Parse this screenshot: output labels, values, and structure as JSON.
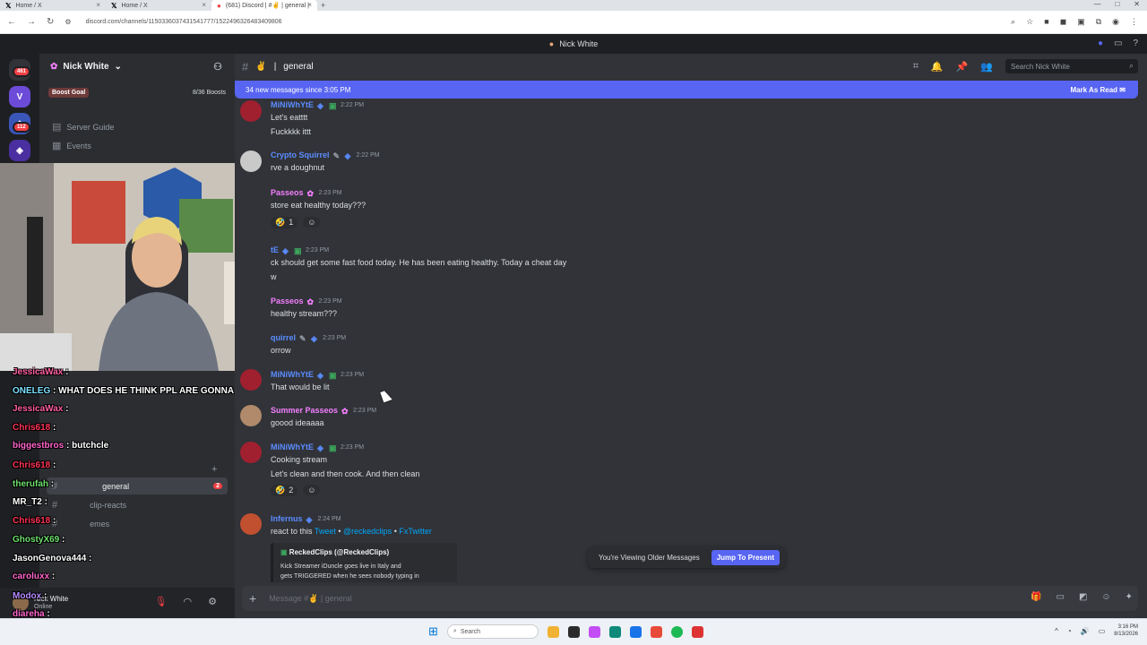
{
  "browser": {
    "tabs": [
      {
        "label": "Home / X",
        "icon": "x-logo-icon"
      },
      {
        "label": "Home / X",
        "icon": "x-logo-icon"
      },
      {
        "label": "(681) Discord | #✌ | general |",
        "icon": "discord-icon"
      }
    ],
    "url": "discord.com/channels/1150336037431541777/1522496326483409806"
  },
  "window_title": "Nick White",
  "server_rail": {
    "badges": [
      "461",
      "112"
    ]
  },
  "sidebar": {
    "server_name": "Nick White",
    "boost_label": "Boost Goal",
    "boost_progress": "8/36 Boosts",
    "nav": [
      {
        "label": "Server Guide",
        "icon": "server-guide-icon"
      },
      {
        "label": "Events",
        "icon": "calendar-icon"
      }
    ],
    "channels": [
      {
        "label": "general",
        "active": true,
        "mentions": "2"
      },
      {
        "label": "clip-reacts",
        "active": false
      },
      {
        "label": "emes",
        "active": false
      }
    ]
  },
  "stream_chat": [
    {
      "user": "JessicaWax",
      "color": "#ff5fa2",
      "msg": ""
    },
    {
      "user": "ONELEG",
      "color": "#7be0ff",
      "msg": "WHAT DOES HE THINK PPL ARE GONNA CLP"
    },
    {
      "user": "JessicaWax",
      "color": "#ff5fa2",
      "msg": ""
    },
    {
      "user": "Chris618",
      "color": "#ff3355",
      "msg": ""
    },
    {
      "user": "biggestbros",
      "color": "#ff66cc",
      "msg": "butchcle"
    },
    {
      "user": "Chris618",
      "color": "#ff3355",
      "msg": ""
    },
    {
      "user": "therufah",
      "color": "#6fe06f",
      "msg": ""
    },
    {
      "user": "MR_T2",
      "color": "#ffffff",
      "msg": ""
    },
    {
      "user": "Chris618",
      "color": "#ff3355",
      "msg": ""
    },
    {
      "user": "GhostyX69",
      "color": "#6fe06f",
      "msg": ""
    },
    {
      "user": "JasonGenova444",
      "color": "#ffffff",
      "msg": ""
    },
    {
      "user": "caroluxx",
      "color": "#ff66cc",
      "msg": ""
    },
    {
      "user": "Modox",
      "color": "#b58cff",
      "msg": ""
    },
    {
      "user": "diareha",
      "color": "#ff66cc",
      "msg": ""
    }
  ],
  "user_panel": {
    "name": "Nick White",
    "status": "Online"
  },
  "channel": {
    "name": "general",
    "search_placeholder": "Search Nick White",
    "new_messages": "34 new messages since 3:05 PM",
    "mark_read": "Mark As Read"
  },
  "messages": [
    {
      "user": "MiNiWhYtE",
      "color": "#5865f2",
      "time": "2:22 PM",
      "lines": [
        "Let's eatttt",
        "Fuckkkk ittt"
      ]
    },
    {
      "user": "Crypto Squirrel",
      "color": "#5865f2",
      "time": "2:22 PM",
      "lines": [
        "rve a doughnut"
      ]
    },
    {
      "user": "Passeos",
      "color": "#f47fff",
      "time": "2:23 PM",
      "lines": [
        "store eat healthy today???"
      ],
      "reaction": "1"
    },
    {
      "user": "tE",
      "color": "#5865f2",
      "time": "2:23 PM",
      "lines": [
        "ck should get some fast food today. He has been eating healthy. Today a cheat day",
        "w"
      ]
    },
    {
      "user": "Passeos",
      "color": "#f47fff",
      "time": "2:23 PM",
      "lines": [
        "healthy stream???"
      ]
    },
    {
      "user": "quirrel",
      "color": "#5865f2",
      "time": "2:23 PM",
      "lines": [
        "orrow"
      ]
    },
    {
      "user": "MiNiWhYtE",
      "color": "#5865f2",
      "time": "2:23 PM",
      "lines": [
        "That would be lit"
      ]
    },
    {
      "user": "Summer Passeos",
      "color": "#f47fff",
      "time": "2:23 PM",
      "lines": [
        "goood ideaaaa"
      ]
    },
    {
      "user": "MiNiWhYtE",
      "color": "#5865f2",
      "time": "2:23 PM",
      "lines": [
        "Cooking stream",
        "Let's clean and then cook. And then clean"
      ],
      "reaction": "2"
    },
    {
      "user": "Infernus",
      "color": "#5865f2",
      "time": "2:24 PM",
      "lines": [
        "react to this"
      ]
    }
  ],
  "tweet_line": {
    "prefix": "react to this ",
    "tweet": "Tweet",
    "handle": "@reckedclips",
    "fx": "FxTwitter",
    "dot": " • "
  },
  "embed": {
    "author": "ReckedClips (@ReckedClips)",
    "body_1": "Kick Streamer iDuncle goes live in Italy and",
    "body_2": "gets TRIGGERED when he sees nobody typing in"
  },
  "older_banner": {
    "text": "You're Viewing Older Messages",
    "jump": "Jump To Present"
  },
  "composer": {
    "placeholder": "Message #✌ | general"
  },
  "taskbar": {
    "search": "Search",
    "time": "3:16 PM",
    "date": "8/13/2026"
  }
}
